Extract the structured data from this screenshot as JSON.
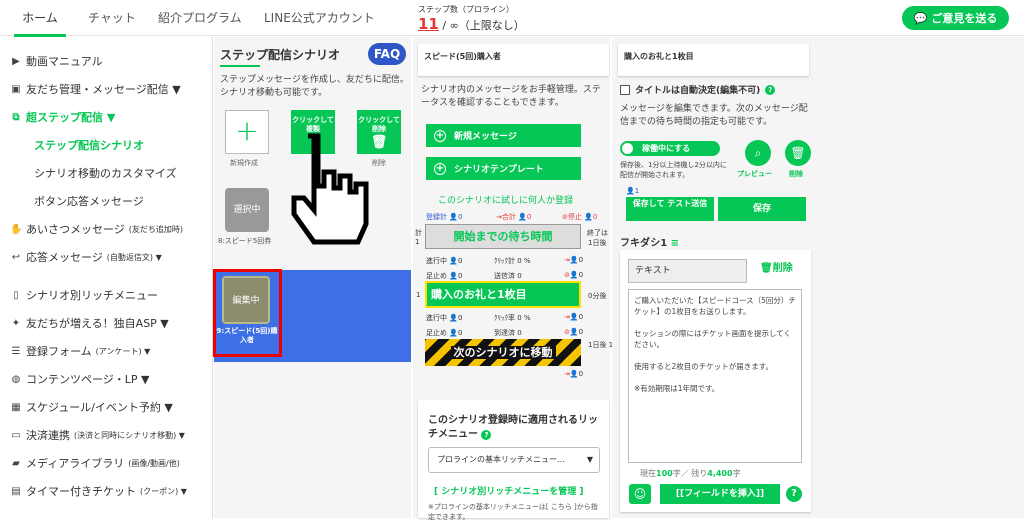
{
  "nav": {
    "tabs": [
      "ホーム",
      "チャット",
      "紹介プログラム",
      "LINE公式アカウント"
    ],
    "steps_label": "ステップ数（プロライン）",
    "steps_used": "11",
    "steps_rest": "/ ∞（上限なし）",
    "feedback": "ご意見を送る"
  },
  "sidebar": {
    "items": [
      {
        "label": "動画マニュアル",
        "icon": "video-icon"
      },
      {
        "label": "友だち管理・メッセージ配信 ▼",
        "icon": "contacts-icon"
      },
      {
        "label": "超ステップ配信 ▼",
        "icon": "sitemap-icon"
      },
      {
        "label": "ステップ配信シナリオ"
      },
      {
        "label": "シナリオ移動のカスタマイズ"
      },
      {
        "label": "ボタン応答メッセージ"
      },
      {
        "label": "あいさつメッセージ",
        "small": "(友だち追加時)",
        "icon": "wave-icon"
      },
      {
        "label": "応答メッセージ",
        "small": "(自動返信文) ▼",
        "icon": "reply-icon"
      },
      {
        "label": "シナリオ別リッチメニュー",
        "icon": "phone-icon"
      },
      {
        "label": "友だちが増える！独自ASP ▼",
        "icon": "handshake-icon"
      },
      {
        "label": "登録フォーム",
        "small": "(アンケート) ▼",
        "icon": "list-icon"
      },
      {
        "label": "コンテンツページ・LP ▼",
        "icon": "globe-icon"
      },
      {
        "label": "スケジュール/イベント予約 ▼",
        "icon": "calendar-icon"
      },
      {
        "label": "決済連携",
        "small": "(決済と同時にシナリオ移動) ▼",
        "icon": "card-icon"
      },
      {
        "label": "メディアライブラリ",
        "small": "(画像/動画/他)",
        "icon": "folder-icon"
      },
      {
        "label": "タイマー付きチケット",
        "small": "(クーポン) ▼",
        "icon": "ticket-icon"
      }
    ]
  },
  "panel1": {
    "title": "ステップ配信シナリオ",
    "faq": "FAQ",
    "desc": "ステップメッセージを作成し、友だちに配信。シナリオ移動も可能です。",
    "new_label": "新規作成",
    "copy": "クリックして複製",
    "delete": "クリックして削除",
    "delete_label": "削除",
    "selected_tile": "選択中",
    "selected_label": "8:スピード5回券",
    "editing_tile": "編集中",
    "editing_label": "9:スピード(5回)購入者"
  },
  "panel2": {
    "header": "スピード(5回)購入者",
    "desc": "シナリオ内のメッセージをお手軽管理。ステータスを確認することもできます。",
    "new_msg": "新規メッセージ",
    "template": "シナリオテンプレート",
    "try_link": "このシナリオに試しに何人か登録",
    "stat_registered": "登録計",
    "stat_total": "合計",
    "stat_stop": "停止",
    "zero": "0",
    "zero_pct": "0 %",
    "stat_progress": "進行中",
    "stat_click": "ｸﾘｯｸ計",
    "stat_stopped": "足止め",
    "stat_sent": "送信済",
    "stat_clickrate": "ｸﾘｯｸ率",
    "stat_reached": "到達済",
    "wait_label": "開始までの待ち時間",
    "wait_side": "終了は",
    "wait_time": "1日後",
    "msg_label": "購入のお礼と1枚目",
    "msg_time": "0分後",
    "next_label": "次のシナリオに移動",
    "next_time": "1日後 17:00",
    "num1": "1",
    "total_prefix": "計",
    "rich_title": "このシナリオ登録時に適用されるリッチメニュー",
    "rich_select": "プロラインの基本リッチメニュー…",
    "rich_manage": "[ シナリオ別リッチメニューを管理 ]",
    "rich_note": "※プロラインの基本リッチメニューは[ こちら ]から指定できます。"
  },
  "panel3": {
    "header": "購入のお礼と1枚目",
    "auto_title": "タイトルは自動決定(編集不可)",
    "desc": "メッセージを編集できます。次のメッセージ配信までの待ち時間の指定も可能です。",
    "toggle": "稼働中にする",
    "toggle_note": "保存後、1分以上待機し2分以内に配信が開始されます。",
    "preview": "プレビュー",
    "trash": "削除",
    "user_count": "1",
    "save_test": "保存して テスト送信",
    "save": "保存",
    "fukidashi": "フキダシ1",
    "text_type": "テキスト",
    "del_bubble": "削除",
    "message": "ご購入いただいた【スピードコース（5回分）チケット】の1枚目をお送りします。\n\nセッションの際にはチケット画面を提示してください。\n\n使用すると2枚目のチケットが届きます。\n\n※有効期限は1年間です。",
    "counter_a": "現在",
    "counter_used": "100",
    "counter_b": "字／ 残り",
    "counter_rest": "4,400",
    "counter_c": "字",
    "field_btn": "[[フィールドを挿入]]",
    "help": "?"
  },
  "colors": {
    "green": "#06c755",
    "blue": "#3f6fe6",
    "red": "#e00000",
    "navy": "#2f56c6"
  }
}
